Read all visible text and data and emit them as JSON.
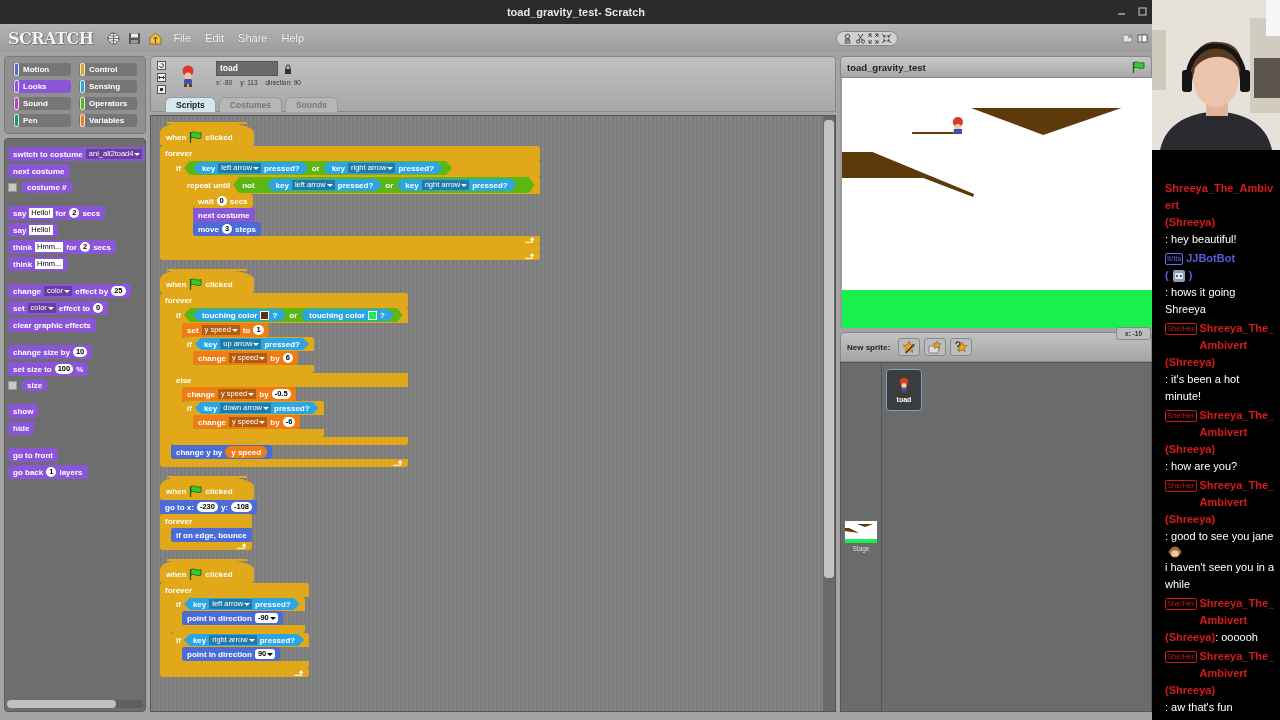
{
  "window": {
    "title": "toad_gravity_test- Scratch"
  },
  "menu_bar": {
    "logo": "SCRATCH",
    "menus": [
      "File",
      "Edit",
      "Share",
      "Help"
    ]
  },
  "categories": [
    {
      "label": "Motion",
      "color": "#4a6cd4",
      "selected": false
    },
    {
      "label": "Control",
      "color": "#e1a91a",
      "selected": false
    },
    {
      "label": "Looks",
      "color": "#8a55d7",
      "selected": true
    },
    {
      "label": "Sensing",
      "color": "#2ca5e2",
      "selected": false
    },
    {
      "label": "Sound",
      "color": "#bb42c3",
      "selected": false
    },
    {
      "label": "Operators",
      "color": "#5cb712",
      "selected": false
    },
    {
      "label": "Pen",
      "color": "#0e9a6c",
      "selected": false
    },
    {
      "label": "Variables",
      "color": "#ee7d16",
      "selected": false
    }
  ],
  "palette": {
    "groups": [
      [
        {
          "kind": "stack",
          "color": "#8a55d7",
          "parts": [
            {
              "kind": "label",
              "text": "switch to costume"
            },
            {
              "kind": "dropdown",
              "text": "ani_all2toad4"
            }
          ]
        },
        {
          "kind": "stack",
          "color": "#8a55d7",
          "parts": [
            {
              "kind": "label",
              "text": "next costume"
            }
          ]
        },
        {
          "kind": "reporter",
          "color": "#8a55d7",
          "checked": false,
          "parts": [
            {
              "kind": "label",
              "text": "costume #"
            }
          ]
        }
      ],
      [
        {
          "kind": "stack",
          "color": "#8a55d7",
          "parts": [
            {
              "kind": "label",
              "text": "say"
            },
            {
              "kind": "text",
              "text": "Hello!"
            },
            {
              "kind": "label",
              "text": "for"
            },
            {
              "kind": "number",
              "text": "2"
            },
            {
              "kind": "label",
              "text": "secs"
            }
          ]
        },
        {
          "kind": "stack",
          "color": "#8a55d7",
          "parts": [
            {
              "kind": "label",
              "text": "say"
            },
            {
              "kind": "text",
              "text": "Hello!"
            }
          ]
        },
        {
          "kind": "stack",
          "color": "#8a55d7",
          "parts": [
            {
              "kind": "label",
              "text": "think"
            },
            {
              "kind": "text",
              "text": "Hmm..."
            },
            {
              "kind": "label",
              "text": "for"
            },
            {
              "kind": "number",
              "text": "2"
            },
            {
              "kind": "label",
              "text": "secs"
            }
          ]
        },
        {
          "kind": "stack",
          "color": "#8a55d7",
          "parts": [
            {
              "kind": "label",
              "text": "think"
            },
            {
              "kind": "text",
              "text": "Hmm..."
            }
          ]
        }
      ],
      [
        {
          "kind": "stack",
          "color": "#8a55d7",
          "parts": [
            {
              "kind": "label",
              "text": "change"
            },
            {
              "kind": "dropdown",
              "text": "color"
            },
            {
              "kind": "label",
              "text": "effect by"
            },
            {
              "kind": "number",
              "text": "25"
            }
          ]
        },
        {
          "kind": "stack",
          "color": "#8a55d7",
          "parts": [
            {
              "kind": "label",
              "text": "set"
            },
            {
              "kind": "dropdown",
              "text": "color"
            },
            {
              "kind": "label",
              "text": "effect to"
            },
            {
              "kind": "number",
              "text": "0"
            }
          ]
        },
        {
          "kind": "stack",
          "color": "#8a55d7",
          "parts": [
            {
              "kind": "label",
              "text": "clear graphic effects"
            }
          ]
        }
      ],
      [
        {
          "kind": "stack",
          "color": "#8a55d7",
          "parts": [
            {
              "kind": "label",
              "text": "change size by"
            },
            {
              "kind": "number",
              "text": "10"
            }
          ]
        },
        {
          "kind": "stack",
          "color": "#8a55d7",
          "parts": [
            {
              "kind": "label",
              "text": "set size to"
            },
            {
              "kind": "number",
              "text": "100"
            },
            {
              "kind": "label",
              "text": "%"
            }
          ]
        },
        {
          "kind": "reporter",
          "color": "#8a55d7",
          "checked": false,
          "parts": [
            {
              "kind": "label",
              "text": "size"
            }
          ]
        }
      ],
      [
        {
          "kind": "stack",
          "color": "#8a55d7",
          "parts": [
            {
              "kind": "label",
              "text": "show"
            }
          ]
        },
        {
          "kind": "stack",
          "color": "#8a55d7",
          "parts": [
            {
              "kind": "label",
              "text": "hide"
            }
          ]
        }
      ],
      [
        {
          "kind": "stack",
          "color": "#8a55d7",
          "parts": [
            {
              "kind": "label",
              "text": "go to front"
            }
          ]
        },
        {
          "kind": "stack",
          "color": "#8a55d7",
          "parts": [
            {
              "kind": "label",
              "text": "go back"
            },
            {
              "kind": "number",
              "text": "1"
            },
            {
              "kind": "label",
              "text": "layers"
            }
          ]
        }
      ]
    ]
  },
  "sprite": {
    "name": "toad",
    "x": "x: -80",
    "y": "y: 113",
    "direction": "direction: 90"
  },
  "tabs": [
    {
      "label": "Scripts",
      "selected": true
    },
    {
      "label": "Costumes",
      "selected": false
    },
    {
      "label": "Sounds",
      "selected": false
    }
  ],
  "scripts": [
    {
      "blocks": [
        {
          "kind": "hat",
          "color": "#e1a91a",
          "parts": [
            {
              "kind": "label",
              "text": "when"
            },
            {
              "kind": "flag"
            },
            {
              "kind": "label",
              "text": "clicked"
            }
          ]
        },
        {
          "kind": "c",
          "color": "#e1a91a",
          "loop": true,
          "parts": [
            {
              "kind": "label",
              "text": "forever"
            }
          ],
          "body": [
            {
              "kind": "c",
              "color": "#e1a91a",
              "loop": false,
              "parts": [
                {
                  "kind": "label",
                  "text": "if"
                },
                {
                  "kind": "block",
                  "block": {
                    "kind": "boolean",
                    "color": "#5cb712",
                    "parts": [
                      {
                        "kind": "block",
                        "block": {
                          "kind": "boolean",
                          "color": "#2ca5e2",
                          "parts": [
                            {
                              "kind": "label",
                              "text": "key"
                            },
                            {
                              "kind": "dropdown",
                              "text": "left arrow"
                            },
                            {
                              "kind": "label",
                              "text": "pressed?"
                            }
                          ]
                        }
                      },
                      {
                        "kind": "label",
                        "text": "or"
                      },
                      {
                        "kind": "block",
                        "block": {
                          "kind": "boolean",
                          "color": "#2ca5e2",
                          "parts": [
                            {
                              "kind": "label",
                              "text": "key"
                            },
                            {
                              "kind": "dropdown",
                              "text": "right arrow"
                            },
                            {
                              "kind": "label",
                              "text": "pressed?"
                            }
                          ]
                        }
                      }
                    ]
                  }
                }
              ],
              "body": [
                {
                  "kind": "c",
                  "color": "#e1a91a",
                  "loop": true,
                  "parts": [
                    {
                      "kind": "label",
                      "text": "repeat until"
                    },
                    {
                      "kind": "block",
                      "block": {
                        "kind": "boolean",
                        "color": "#5cb712",
                        "parts": [
                          {
                            "kind": "label",
                            "text": "not"
                          },
                          {
                            "kind": "block",
                            "block": {
                              "kind": "boolean",
                              "color": "#5cb712",
                              "parts": [
                                {
                                  "kind": "block",
                                  "block": {
                                    "kind": "boolean",
                                    "color": "#2ca5e2",
                                    "parts": [
                                      {
                                        "kind": "label",
                                        "text": "key"
                                      },
                                      {
                                        "kind": "dropdown",
                                        "text": "left arrow"
                                      },
                                      {
                                        "kind": "label",
                                        "text": "pressed?"
                                      }
                                    ]
                                  }
                                },
                                {
                                  "kind": "label",
                                  "text": "or"
                                },
                                {
                                  "kind": "block",
                                  "block": {
                                    "kind": "boolean",
                                    "color": "#2ca5e2",
                                    "parts": [
                                      {
                                        "kind": "label",
                                        "text": "key"
                                      },
                                      {
                                        "kind": "dropdown",
                                        "text": "right arrow"
                                      },
                                      {
                                        "kind": "label",
                                        "text": "pressed?"
                                      }
                                    ]
                                  }
                                }
                              ]
                            }
                          }
                        ]
                      }
                    }
                  ],
                  "body": [
                    {
                      "kind": "stack",
                      "color": "#e1a91a",
                      "parts": [
                        {
                          "kind": "label",
                          "text": "wait"
                        },
                        {
                          "kind": "number",
                          "text": "0"
                        },
                        {
                          "kind": "label",
                          "text": "secs"
                        }
                      ]
                    },
                    {
                      "kind": "stack",
                      "color": "#8a55d7",
                      "parts": [
                        {
                          "kind": "label",
                          "text": "next costume"
                        }
                      ]
                    },
                    {
                      "kind": "stack",
                      "color": "#4a6cd4",
                      "parts": [
                        {
                          "kind": "label",
                          "text": "move"
                        },
                        {
                          "kind": "number",
                          "text": "3"
                        },
                        {
                          "kind": "label",
                          "text": "steps"
                        }
                      ]
                    }
                  ]
                }
              ]
            }
          ]
        }
      ]
    },
    {
      "blocks": [
        {
          "kind": "hat",
          "color": "#e1a91a",
          "parts": [
            {
              "kind": "label",
              "text": "when"
            },
            {
              "kind": "flag"
            },
            {
              "kind": "label",
              "text": "clicked"
            }
          ]
        },
        {
          "kind": "c",
          "color": "#e1a91a",
          "loop": true,
          "parts": [
            {
              "kind": "label",
              "text": "forever"
            }
          ],
          "body": [
            {
              "kind": "ifelse",
              "color": "#e1a91a",
              "else_label": "else",
              "parts": [
                {
                  "kind": "label",
                  "text": "if"
                },
                {
                  "kind": "block",
                  "block": {
                    "kind": "boolean",
                    "color": "#5cb712",
                    "parts": [
                      {
                        "kind": "block",
                        "block": {
                          "kind": "boolean",
                          "color": "#2ca5e2",
                          "parts": [
                            {
                              "kind": "label",
                              "text": "touching color"
                            },
                            {
                              "kind": "color",
                              "color": "#5a3208"
                            },
                            {
                              "kind": "label",
                              "text": "?"
                            }
                          ]
                        }
                      },
                      {
                        "kind": "label",
                        "text": "or"
                      },
                      {
                        "kind": "block",
                        "block": {
                          "kind": "boolean",
                          "color": "#2ca5e2",
                          "parts": [
                            {
                              "kind": "label",
                              "text": "touching color"
                            },
                            {
                              "kind": "color",
                              "color": "#19f050"
                            },
                            {
                              "kind": "label",
                              "text": "?"
                            }
                          ]
                        }
                      }
                    ]
                  }
                }
              ],
              "body": [
                {
                  "kind": "stack",
                  "color": "#ee7d16",
                  "parts": [
                    {
                      "kind": "label",
                      "text": "set"
                    },
                    {
                      "kind": "dropdown",
                      "text": "y speed"
                    },
                    {
                      "kind": "label",
                      "text": "to"
                    },
                    {
                      "kind": "number",
                      "text": "1"
                    }
                  ]
                },
                {
                  "kind": "c",
                  "color": "#e1a91a",
                  "loop": false,
                  "parts": [
                    {
                      "kind": "label",
                      "text": "if"
                    },
                    {
                      "kind": "block",
                      "block": {
                        "kind": "boolean",
                        "color": "#2ca5e2",
                        "parts": [
                          {
                            "kind": "label",
                            "text": "key"
                          },
                          {
                            "kind": "dropdown",
                            "text": "up arrow"
                          },
                          {
                            "kind": "label",
                            "text": "pressed?"
                          }
                        ]
                      }
                    }
                  ],
                  "body": [
                    {
                      "kind": "stack",
                      "color": "#ee7d16",
                      "parts": [
                        {
                          "kind": "label",
                          "text": "change"
                        },
                        {
                          "kind": "dropdown",
                          "text": "y speed"
                        },
                        {
                          "kind": "label",
                          "text": "by"
                        },
                        {
                          "kind": "number",
                          "text": "6"
                        }
                      ]
                    }
                  ]
                }
              ],
              "else_body": [
                {
                  "kind": "stack",
                  "color": "#ee7d16",
                  "parts": [
                    {
                      "kind": "label",
                      "text": "change"
                    },
                    {
                      "kind": "dropdown",
                      "text": "y speed"
                    },
                    {
                      "kind": "label",
                      "text": "by"
                    },
                    {
                      "kind": "number",
                      "text": "-0.5"
                    }
                  ]
                },
                {
                  "kind": "c",
                  "color": "#e1a91a",
                  "loop": false,
                  "parts": [
                    {
                      "kind": "label",
                      "text": "if"
                    },
                    {
                      "kind": "block",
                      "block": {
                        "kind": "boolean",
                        "color": "#2ca5e2",
                        "parts": [
                          {
                            "kind": "label",
                            "text": "key"
                          },
                          {
                            "kind": "dropdown",
                            "text": "down arrow"
                          },
                          {
                            "kind": "label",
                            "text": "pressed?"
                          }
                        ]
                      }
                    }
                  ],
                  "body": [
                    {
                      "kind": "stack",
                      "color": "#ee7d16",
                      "parts": [
                        {
                          "kind": "label",
                          "text": "change"
                        },
                        {
                          "kind": "dropdown",
                          "text": "y speed"
                        },
                        {
                          "kind": "label",
                          "text": "by"
                        },
                        {
                          "kind": "number",
                          "text": "-6"
                        }
                      ]
                    }
                  ]
                }
              ]
            },
            {
              "kind": "stack",
              "color": "#4a6cd4",
              "parts": [
                {
                  "kind": "label",
                  "text": "change y by"
                },
                {
                  "kind": "block",
                  "block": {
                    "kind": "reporter",
                    "color": "#ee7d16",
                    "parts": [
                      {
                        "kind": "label",
                        "text": "y speed"
                      }
                    ]
                  }
                }
              ]
            }
          ]
        }
      ]
    },
    {
      "blocks": [
        {
          "kind": "hat",
          "color": "#e1a91a",
          "parts": [
            {
              "kind": "label",
              "text": "when"
            },
            {
              "kind": "flag"
            },
            {
              "kind": "label",
              "text": "clicked"
            }
          ]
        },
        {
          "kind": "stack",
          "color": "#4a6cd4",
          "parts": [
            {
              "kind": "label",
              "text": "go to x:"
            },
            {
              "kind": "number",
              "text": "-230"
            },
            {
              "kind": "label",
              "text": "y:"
            },
            {
              "kind": "number",
              "text": "-108"
            }
          ]
        },
        {
          "kind": "c",
          "color": "#e1a91a",
          "loop": true,
          "parts": [
            {
              "kind": "label",
              "text": "forever"
            }
          ],
          "body": [
            {
              "kind": "stack",
              "color": "#4a6cd4",
              "parts": [
                {
                  "kind": "label",
                  "text": "if on edge, bounce"
                }
              ]
            }
          ]
        }
      ]
    },
    {
      "blocks": [
        {
          "kind": "hat",
          "color": "#e1a91a",
          "parts": [
            {
              "kind": "label",
              "text": "when"
            },
            {
              "kind": "flag"
            },
            {
              "kind": "label",
              "text": "clicked"
            }
          ]
        },
        {
          "kind": "c",
          "color": "#e1a91a",
          "loop": true,
          "parts": [
            {
              "kind": "label",
              "text": "forever"
            }
          ],
          "body": [
            {
              "kind": "c",
              "color": "#e1a91a",
              "loop": false,
              "parts": [
                {
                  "kind": "label",
                  "text": "if"
                },
                {
                  "kind": "block",
                  "block": {
                    "kind": "boolean",
                    "color": "#2ca5e2",
                    "parts": [
                      {
                        "kind": "label",
                        "text": "key"
                      },
                      {
                        "kind": "dropdown",
                        "text": "left arrow"
                      },
                      {
                        "kind": "label",
                        "text": "pressed?"
                      }
                    ]
                  }
                }
              ],
              "body": [
                {
                  "kind": "stack",
                  "color": "#4a6cd4",
                  "parts": [
                    {
                      "kind": "label",
                      "text": "point in direction"
                    },
                    {
                      "kind": "numdrop",
                      "text": "-90"
                    }
                  ]
                }
              ]
            },
            {
              "kind": "c",
              "color": "#e1a91a",
              "loop": false,
              "parts": [
                {
                  "kind": "label",
                  "text": "if"
                },
                {
                  "kind": "block",
                  "block": {
                    "kind": "boolean",
                    "color": "#2ca5e2",
                    "parts": [
                      {
                        "kind": "label",
                        "text": "key"
                      },
                      {
                        "kind": "dropdown",
                        "text": "right arrow"
                      },
                      {
                        "kind": "label",
                        "text": "pressed?"
                      }
                    ]
                  }
                }
              ],
              "body": [
                {
                  "kind": "stack",
                  "color": "#4a6cd4",
                  "parts": [
                    {
                      "kind": "label",
                      "text": "point in direction"
                    },
                    {
                      "kind": "numdrop",
                      "text": "90"
                    }
                  ]
                }
              ]
            }
          ]
        }
      ]
    }
  ],
  "stage": {
    "title": "toad_gravity_test",
    "mouse_x": "x: -10"
  },
  "new_sprite": {
    "label": "New sprite:"
  },
  "sprites": [
    {
      "name": "toad",
      "selected": true
    }
  ],
  "stage_thumbnail": {
    "label": "Stage"
  },
  "chat": {
    "messages": [
      {
        "author": "Shreeya_The_Ambivert",
        "color": "#d41a1a",
        "login": [
          {
            "kind": "text",
            "text": "(Shreeya)"
          }
        ],
        "body": [
          {
            "kind": "text",
            "text": ": hey beautiful!"
          }
        ]
      },
      {
        "badges": [
          {
            "label": "It/Its",
            "color": "#6a6af0"
          }
        ],
        "author": "JJBotBot",
        "color": "#5b5bdc",
        "login": [
          {
            "kind": "text",
            "text": "("
          },
          {
            "kind": "robot"
          },
          {
            "kind": "text",
            "text": ")"
          }
        ],
        "body": [
          {
            "kind": "text",
            "text": ": hows it going Shreeya"
          }
        ]
      },
      {
        "badges": [
          {
            "label": "She/Her",
            "color": "#c81818"
          }
        ],
        "author": "Shreeya_The_Ambivert",
        "color": "#d41a1a",
        "login": [
          {
            "kind": "text",
            "text": "(Shreeya)"
          }
        ],
        "body": [
          {
            "kind": "text",
            "text": ": it's been a hot minute!"
          }
        ]
      },
      {
        "badges": [
          {
            "label": "She/Her",
            "color": "#c81818"
          }
        ],
        "author": "Shreeya_The_Ambivert",
        "color": "#d41a1a",
        "login": [
          {
            "kind": "text",
            "text": "(Shreeya)"
          }
        ],
        "body": [
          {
            "kind": "text",
            "text": ": how are you?"
          }
        ]
      },
      {
        "badges": [
          {
            "label": "She/Her",
            "color": "#c81818"
          }
        ],
        "author": "Shreeya_The_Ambivert",
        "color": "#d41a1a",
        "login": [
          {
            "kind": "text",
            "text": "(Shreeya)"
          }
        ],
        "body": [
          {
            "kind": "text",
            "text": ": good to see you jane"
          },
          {
            "kind": "monkey"
          },
          {
            "kind": "text",
            "text": "i haven't seen you in a while"
          }
        ]
      },
      {
        "badges": [
          {
            "label": "She/Her",
            "color": "#c81818"
          }
        ],
        "author": "Shreeya_The_Ambivert",
        "color": "#d41a1a",
        "login": [
          {
            "kind": "text",
            "text": "(Shreeya)"
          }
        ],
        "body": [
          {
            "kind": "text",
            "text": ": oooooh"
          }
        ]
      },
      {
        "badges": [
          {
            "label": "She/Her",
            "color": "#c81818"
          }
        ],
        "author": "Shreeya_The_Ambivert",
        "color": "#d41a1a",
        "login": [
          {
            "kind": "text",
            "text": "(Shreeya)"
          }
        ],
        "body": [
          {
            "kind": "text",
            "text": ": aw that's fun"
          }
        ]
      }
    ]
  }
}
